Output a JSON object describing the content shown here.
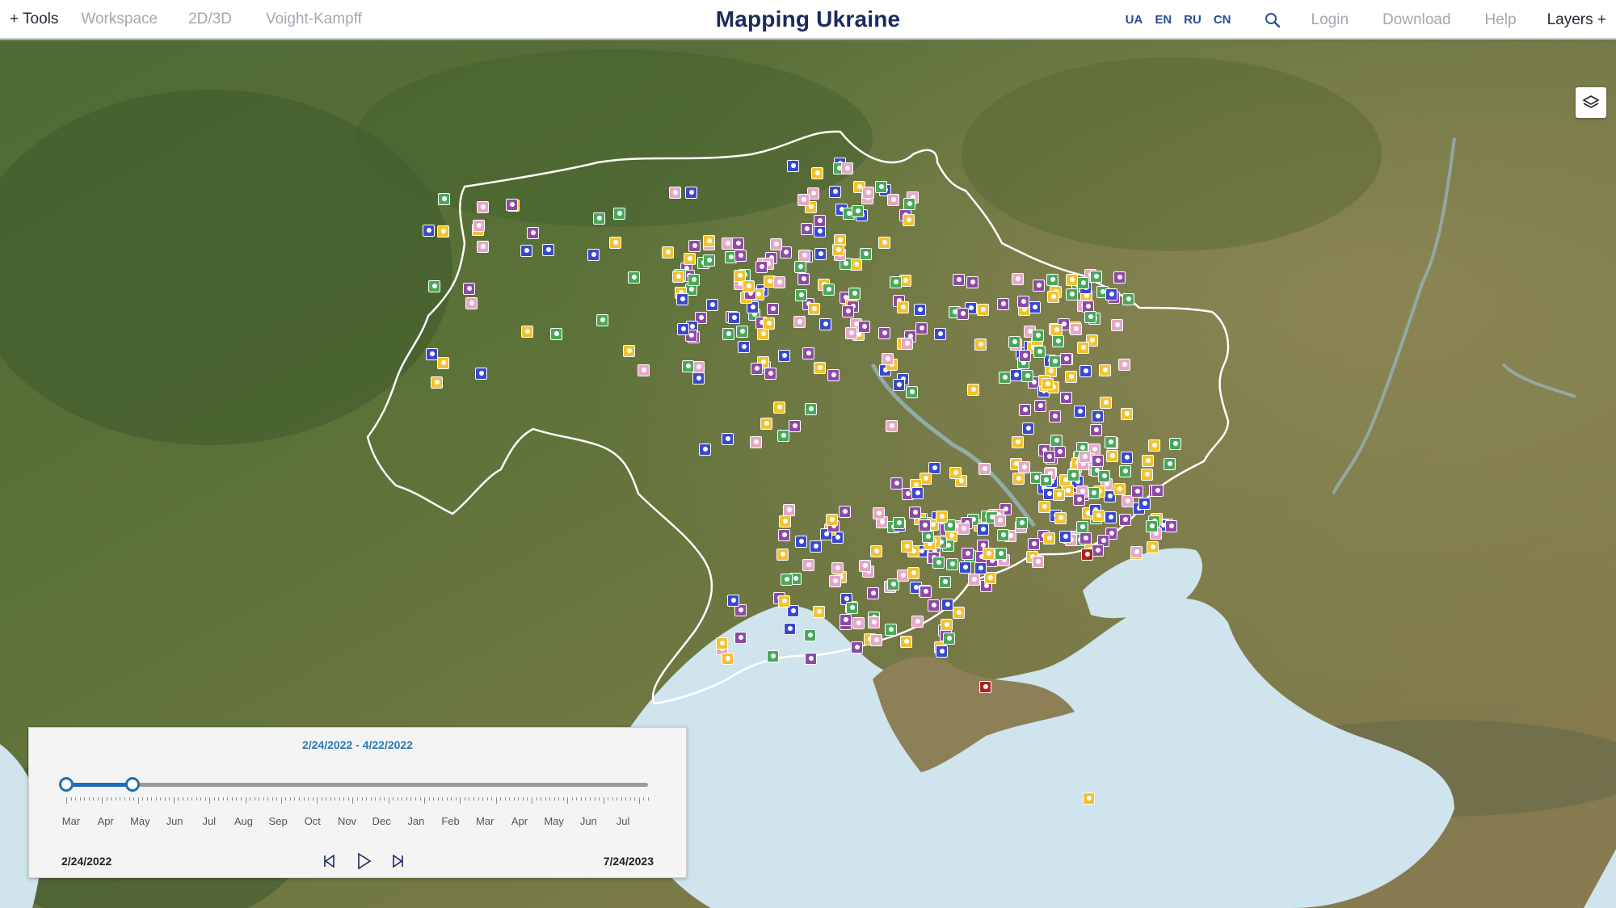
{
  "header": {
    "tools_label": "+ Tools",
    "workspace_label": "Workspace",
    "view_label": "2D/3D",
    "voight_label": "Voight-Kampff",
    "title": "Mapping Ukraine",
    "languages": [
      "UA",
      "EN",
      "RU",
      "CN"
    ],
    "login_label": "Login",
    "download_label": "Download",
    "help_label": "Help",
    "layers_label": "Layers +"
  },
  "icons": {
    "search": "search-icon",
    "layers": "layers-icon",
    "prev": "step-back-icon",
    "play": "play-icon",
    "next": "step-forward-icon"
  },
  "timeline": {
    "range_start": "2/24/2022",
    "range_end": "4/22/2022",
    "range_separator": "-",
    "start_date": "2/24/2022",
    "end_date": "7/24/2023",
    "months": [
      "Mar",
      "Apr",
      "May",
      "Jun",
      "Jul",
      "Aug",
      "Sep",
      "Oct",
      "Nov",
      "Dec",
      "Jan",
      "Feb",
      "Mar",
      "Apr",
      "May",
      "Jun",
      "Jul"
    ],
    "selection_fraction": [
      0.0,
      0.114
    ]
  },
  "colors": {
    "accent": "#1f6fb2",
    "title": "#1b2a5e",
    "marker_yellow": "#f2c230",
    "marker_blue": "#3b49cc",
    "marker_purple": "#8e4aa6",
    "marker_green": "#4aa85c",
    "marker_pink": "#e6a7c8",
    "marker_red": "#b32020"
  }
}
